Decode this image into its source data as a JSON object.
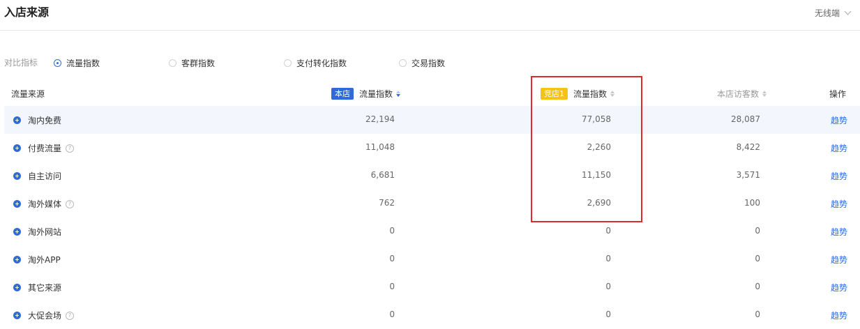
{
  "header": {
    "title": "入店来源",
    "device": "无线端"
  },
  "compare": {
    "label": "对比指标",
    "options": [
      "流量指数",
      "客群指数",
      "支付转化指数",
      "交易指数"
    ],
    "selected": "流量指数"
  },
  "columns": {
    "source": "流量来源",
    "own_badge": "本店",
    "own_metric": "流量指数",
    "competitor_badge": "竞店1",
    "competitor_metric": "流量指数",
    "own_visitors": "本店访客数",
    "action": "操作"
  },
  "rows": [
    {
      "name": "淘内免费",
      "help": false,
      "own": "22,194",
      "competitor": "77,058",
      "visitors": "28,087",
      "action": "趋势"
    },
    {
      "name": "付费流量",
      "help": true,
      "own": "11,048",
      "competitor": "2,260",
      "visitors": "8,422",
      "action": "趋势"
    },
    {
      "name": "自主访问",
      "help": false,
      "own": "6,681",
      "competitor": "11,150",
      "visitors": "3,571",
      "action": "趋势"
    },
    {
      "name": "淘外媒体",
      "help": true,
      "own": "762",
      "competitor": "2,690",
      "visitors": "100",
      "action": "趋势"
    },
    {
      "name": "淘外网站",
      "help": false,
      "own": "0",
      "competitor": "0",
      "visitors": "0",
      "action": "趋势"
    },
    {
      "name": "淘外APP",
      "help": false,
      "own": "0",
      "competitor": "0",
      "visitors": "0",
      "action": "趋势"
    },
    {
      "name": "其它来源",
      "help": false,
      "own": "0",
      "competitor": "0",
      "visitors": "0",
      "action": "趋势"
    },
    {
      "name": "大促会场",
      "help": true,
      "own": "0",
      "competitor": "0",
      "visitors": "0",
      "action": "趋势"
    }
  ],
  "colors": {
    "accent": "#2f6ad8",
    "competitor_badge": "#f2c417",
    "annotation_box": "#e0292c",
    "row_highlight": "#f3f7fd"
  }
}
